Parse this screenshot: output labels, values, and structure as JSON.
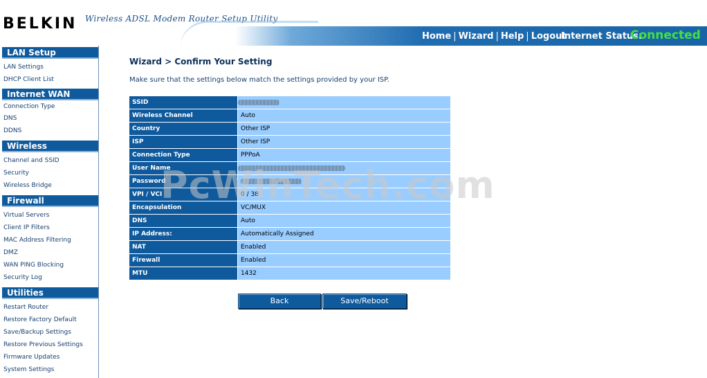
{
  "header": {
    "logo": "BELKIN",
    "tagline": "Wireless ADSL Modem Router Setup Utility",
    "nav": [
      "Home",
      "Wizard",
      "Help",
      "Logout"
    ],
    "nav_sep": "|",
    "internet_status_label": "Internet Status:",
    "internet_status_value": "Connected"
  },
  "sidebar": {
    "sections": [
      {
        "title": "LAN Setup",
        "items": [
          "LAN Settings",
          "DHCP Client List"
        ]
      },
      {
        "title": "Internet WAN",
        "items": [
          "Connection Type",
          "DNS",
          "DDNS"
        ]
      },
      {
        "title": "Wireless",
        "items": [
          "Channel and SSID",
          "Security",
          "Wireless Bridge"
        ]
      },
      {
        "title": "Firewall",
        "items": [
          "Virtual Servers",
          "Client IP Filters",
          "MAC Address Filtering",
          "DMZ",
          "WAN PING Blocking",
          "Security Log"
        ]
      },
      {
        "title": "Utilities",
        "items": [
          "Restart Router",
          "Restore Factory Default",
          "Save/Backup Settings",
          "Restore Previous Settings",
          "Firmware Updates",
          "System Settings"
        ]
      }
    ]
  },
  "main": {
    "title": "Wizard > Confirm Your Setting",
    "description": "Make sure that the settings below match the settings provided by your ISP.",
    "rows": [
      {
        "label": "SSID",
        "value": ""
      },
      {
        "label": "Wireless Channel",
        "value": "Auto"
      },
      {
        "label": "Country",
        "value": "Other ISP"
      },
      {
        "label": "ISP",
        "value": "Other ISP"
      },
      {
        "label": "Connection Type",
        "value": "PPPoA"
      },
      {
        "label": "User Name",
        "value": ""
      },
      {
        "label": "Password",
        "value": ""
      },
      {
        "label": "VPI / VCI",
        "value": "0 / 38"
      },
      {
        "label": "Encapsulation",
        "value": "VC/MUX"
      },
      {
        "label": "DNS",
        "value": "Auto"
      },
      {
        "label": "IP Address:",
        "value": "Automatically Assigned"
      },
      {
        "label": "NAT",
        "value": "Enabled"
      },
      {
        "label": "Firewall",
        "value": "Enabled"
      },
      {
        "label": "MTU",
        "value": "1432"
      }
    ],
    "buttons": {
      "back": "Back",
      "save_reboot": "Save/Reboot"
    }
  },
  "watermark": "PcWinTech.com",
  "colors": {
    "accent": "#0f5a9d",
    "value_bg": "#99ccff",
    "status_connected": "#42e33b"
  }
}
